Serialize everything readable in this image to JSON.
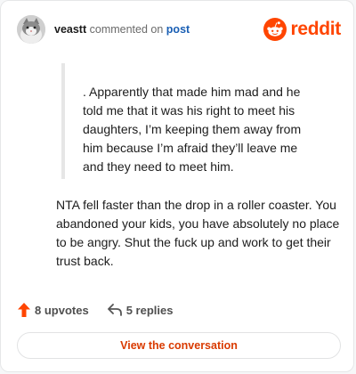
{
  "header": {
    "username": "veastt",
    "action_text": "commented on",
    "post_link": "post",
    "brand": "reddit",
    "avatar_icon": "cat-avatar-icon"
  },
  "quote": {
    "text": ". Apparently that made him mad and he told me that it was his right to meet his daughters, I’m keeping them away from him because I’m afraid they’ll leave me and they need to meet him."
  },
  "comment": {
    "text": "NTA fell faster than the drop in a roller coaster. You abandoned your kids, you have absolutely no place to be angry. Shut the fuck up and work to get their trust back."
  },
  "actions": {
    "upvotes_label": "8 upvotes",
    "replies_label": "5 replies",
    "upvote_icon": "upvote-arrow-icon",
    "reply_icon": "reply-arrow-icon"
  },
  "cta": {
    "label": "View the conversation"
  },
  "colors": {
    "brand": "#ff4500",
    "link": "#1a5fb4",
    "cta": "#d93a00"
  }
}
